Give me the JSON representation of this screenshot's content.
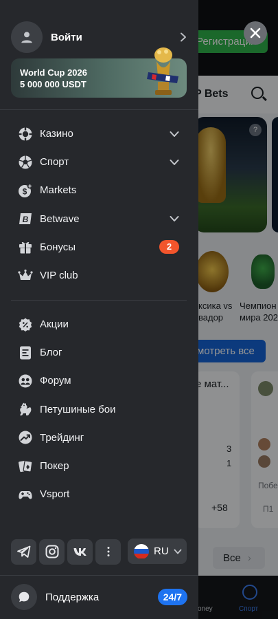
{
  "header": {
    "login_label": "Войти"
  },
  "promo": {
    "line1": "World Cup 2026",
    "line2": "5 000 000 USDT"
  },
  "menu_primary": [
    {
      "label": "Казино",
      "icon": "casino-chip-icon",
      "expandable": true
    },
    {
      "label": "Спорт",
      "icon": "soccer-ball-icon",
      "expandable": true
    },
    {
      "label": "Markets",
      "icon": "markets-coin-icon",
      "expandable": false
    },
    {
      "label": "Betwave",
      "icon": "betwave-logo-icon",
      "expandable": true
    },
    {
      "label": "Бонусы",
      "icon": "gift-icon",
      "expandable": false,
      "badge": "2"
    },
    {
      "label": "VIP club",
      "icon": "crown-icon",
      "expandable": false
    }
  ],
  "menu_secondary": [
    {
      "label": "Акции",
      "icon": "promo-percent-icon"
    },
    {
      "label": "Блог",
      "icon": "blog-document-icon"
    },
    {
      "label": "Форум",
      "icon": "forum-people-icon"
    },
    {
      "label": "Петушиные бои",
      "icon": "rooster-icon"
    },
    {
      "label": "Трейдинг",
      "icon": "trading-chart-icon"
    },
    {
      "label": "Покер",
      "icon": "poker-cards-icon"
    },
    {
      "label": "Vsport",
      "icon": "gamepad-icon"
    }
  ],
  "socials": [
    "telegram-icon",
    "instagram-icon",
    "vk-icon",
    "more-dots-icon"
  ],
  "language": {
    "code": "RU"
  },
  "support": {
    "label": "Поддержка",
    "badge": "24/7"
  },
  "background": {
    "register_label": "Регистрация",
    "section_title": "P Bets",
    "cat1_line1": "ксика vs",
    "cat1_line2": "вадор",
    "cat2_line1": "Чемпион",
    "cat2_line2": "мира 202",
    "see_all_label": "мотреть все",
    "card_title": "е мат...",
    "score_a": "3",
    "score_b": "1",
    "more_markets": "+58",
    "pobe": "Побе",
    "p1": "П1",
    "all_label": "Все",
    "nav_money": "oney",
    "nav_sport": "Спорт"
  },
  "colors": {
    "drawer_bg": "#26282c",
    "badge_orange": "#f2552c",
    "support_blue": "#1e73f0",
    "register_green": "#2fb34a"
  }
}
